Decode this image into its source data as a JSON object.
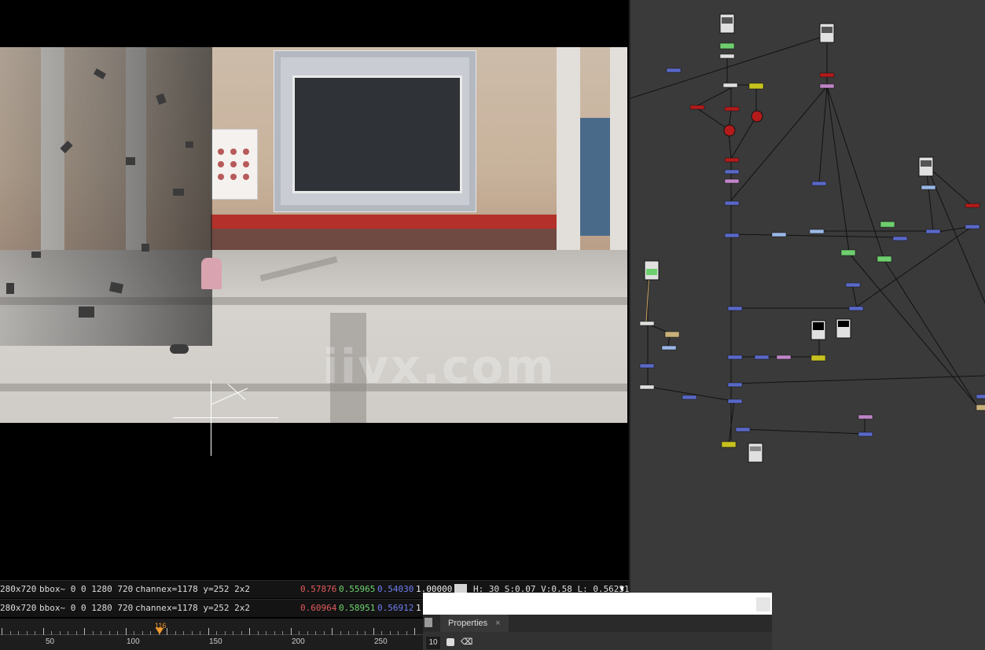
{
  "viewer": {
    "watermark": "iivx.com",
    "info_top": {
      "format": "280x720",
      "bbox": "bbox~ 0 0 1280 720",
      "channel": "channe",
      "coords": "x=1178 y=252 2x2",
      "r": "0.57876",
      "g": "0.55965",
      "b": "0.54030",
      "a": "1.00000",
      "hsvl": "H: 30 S:0.07 V:0.58  L: 0.56231"
    },
    "info_bottom": {
      "format": "280x720",
      "bbox": "bbox~ 0 0 1280 720",
      "channel": "channe",
      "coords": "x=1178 y=252 2x2",
      "r": "0.60964",
      "g": "0.58951",
      "b": "0.56912",
      "a": "1."
    }
  },
  "timeline": {
    "current_frame": "116",
    "labels": [
      "50",
      "100",
      "150",
      "200",
      "250"
    ]
  },
  "properties": {
    "tab_label": "Properties",
    "close_glyph": "×",
    "max_panels": "10",
    "clear_glyph": "⌫"
  },
  "colors": {
    "node_blue": "#5968c8",
    "node_green": "#6ecf6e",
    "node_red": "#b31b1b",
    "node_pink": "#c085c8",
    "node_yellow": "#c8c21e",
    "node_tan": "#c8b07a",
    "node_light_blue": "#9ab8e8",
    "graph_bg": "#3a3a3a",
    "timeline_marker": "#f29a2e"
  }
}
